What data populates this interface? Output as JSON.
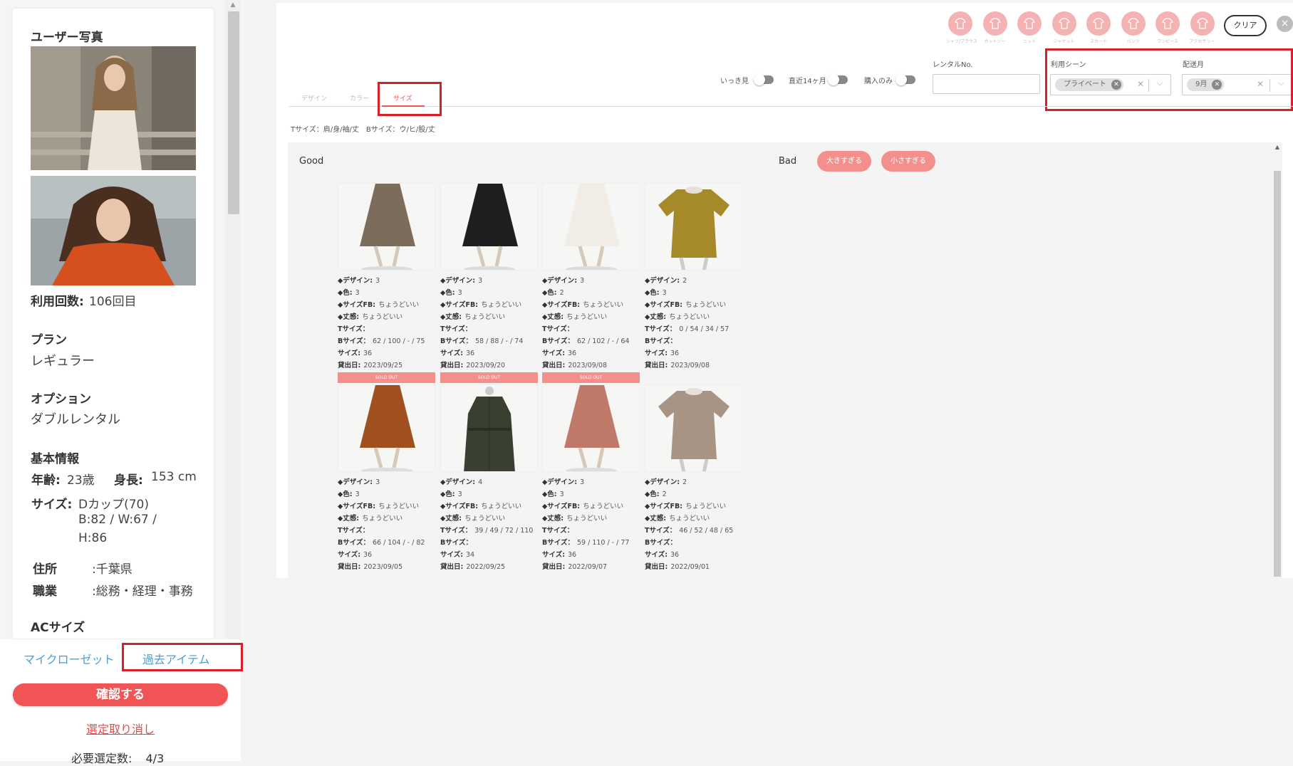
{
  "sidebar": {
    "photo_title": "ユーザー写真",
    "usage_label": "利用回数:",
    "usage_value": "106回目",
    "plan_title": "プラン",
    "plan_value": "レギュラー",
    "option_title": "オプション",
    "option_value": "ダブルレンタル",
    "basic_title": "基本情報",
    "age_label": "年齢:",
    "age_value": "23歳",
    "height_label": "身長:",
    "height_value": "153 cm",
    "size_label": "サイズ:",
    "size_value": "Dカップ(70)",
    "size_bw": "B:82 / W:67 /",
    "size_h": "H:86",
    "address_label": "住所",
    "address_value": ":千葉県",
    "job_label": "職業",
    "job_value": ":総務・経理・事務",
    "ac_title": "ACサイズ",
    "tab_closet": "マイクローゼット",
    "tab_past": "過去アイテム",
    "confirm": "確認する",
    "cancel": "選定取り消し",
    "required_label": "必要選定数:",
    "required_value": "4/3"
  },
  "categories": [
    {
      "label": "シャツ/ブラウス",
      "icon": "shirt-icon"
    },
    {
      "label": "カットソー",
      "icon": "cutsew-icon"
    },
    {
      "label": "ニット",
      "icon": "knit-icon"
    },
    {
      "label": "ジャケット",
      "icon": "jacket-icon"
    },
    {
      "label": "スカート",
      "icon": "skirt-icon"
    },
    {
      "label": "パンツ",
      "icon": "pants-icon"
    },
    {
      "label": "ワンピース",
      "icon": "dress-icon"
    },
    {
      "label": "アクセサリー",
      "icon": "accessory-icon"
    }
  ],
  "header": {
    "clear": "クリア",
    "close": "×"
  },
  "filters": {
    "toggle_ikki": "いっき見",
    "toggle_recent": "直近14ヶ月",
    "toggle_purchase": "購入のみ",
    "rental_no_label": "レンタルNo.",
    "scene_label": "利用シーン",
    "scene_chip": "プライベート",
    "month_label": "配送月",
    "month_chip": "9月"
  },
  "subtabs": {
    "design": "デザイン",
    "color": "カラー",
    "size": "サイズ"
  },
  "size_legend": "Tサイズ：肩/身/袖/丈　Bサイズ：ウ/ヒ/股/丈",
  "grid": {
    "good": "Good",
    "bad": "Bad",
    "too_big": "大きすぎる",
    "too_small": "小さすぎる"
  },
  "labels": {
    "design": "◆デザイン:",
    "color": "◆色:",
    "sizefb": "◆サイズFB:",
    "feel": "◆丈感:",
    "tsize": "Tサイズ：",
    "bsize": "Bサイズ：",
    "size": "サイズ:",
    "shipped": "貸出日:",
    "soldout": "SOLD OUT"
  },
  "items": [
    {
      "design": "3",
      "color": "3",
      "sizefb": "ちょうどいい",
      "feel": "ちょうどいい",
      "tsize": "",
      "bsize": "62 / 100 / - / 75",
      "size": "36",
      "shipped": "2023/09/25",
      "soldout": false,
      "kind": "skirt",
      "hex": "#7b6c5c"
    },
    {
      "design": "3",
      "color": "3",
      "sizefb": "ちょうどいい",
      "feel": "ちょうどいい",
      "tsize": "",
      "bsize": "58 / 88 / - / 74",
      "size": "36",
      "shipped": "2023/09/20",
      "soldout": false,
      "kind": "skirt",
      "hex": "#1e1e1e"
    },
    {
      "design": "3",
      "color": "2",
      "sizefb": "ちょうどいい",
      "feel": "ちょうどいい",
      "tsize": "",
      "bsize": "62 / 102 / - / 64",
      "size": "36",
      "shipped": "2023/09/08",
      "soldout": false,
      "kind": "skirt",
      "hex": "#f1ede6"
    },
    {
      "design": "2",
      "color": "3",
      "sizefb": "ちょうどいい",
      "feel": "ちょうどいい",
      "tsize": "0 / 54 / 34 / 57",
      "bsize": "",
      "size": "36",
      "shipped": "2023/09/08",
      "soldout": false,
      "kind": "top",
      "hex": "#a68a2a"
    },
    {
      "design": "3",
      "color": "3",
      "sizefb": "ちょうどいい",
      "feel": "ちょうどいい",
      "tsize": "",
      "bsize": "66 / 104 / - / 82",
      "size": "36",
      "shipped": "2023/09/05",
      "soldout": true,
      "kind": "skirt",
      "hex": "#a0501e"
    },
    {
      "design": "4",
      "color": "3",
      "sizefb": "ちょうどいい",
      "feel": "ちょうどいい",
      "tsize": "39 / 49 / 72 / 110",
      "bsize": "",
      "size": "34",
      "shipped": "2022/09/25",
      "soldout": true,
      "kind": "coat",
      "hex": "#3a4030"
    },
    {
      "design": "3",
      "color": "3",
      "sizefb": "ちょうどいい",
      "feel": "ちょうどいい",
      "tsize": "",
      "bsize": "59 / 110 / - / 77",
      "size": "36",
      "shipped": "2022/09/07",
      "soldout": true,
      "kind": "skirt",
      "hex": "#c07868"
    },
    {
      "design": "2",
      "color": "2",
      "sizefb": "ちょうどいい",
      "feel": "ちょうどいい",
      "tsize": "46 / 52 / 48 / 65",
      "bsize": "",
      "size": "36",
      "shipped": "2022/09/01",
      "soldout": false,
      "kind": "top",
      "hex": "#a89484"
    }
  ],
  "colors": {
    "accent": "#f05454",
    "highlight_box": "#d8202a",
    "link": "#4a9fd8",
    "category_icon": "#f4b2b2"
  }
}
